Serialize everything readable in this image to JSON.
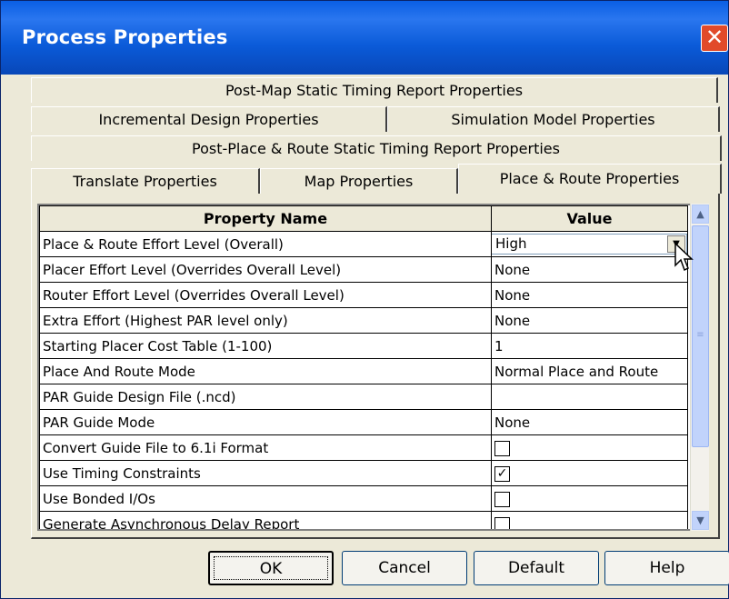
{
  "window": {
    "title": "Process Properties",
    "close_label": "✕"
  },
  "tabs": {
    "row1": [
      "Post-Map Static Timing Report Properties"
    ],
    "row2": [
      "Incremental Design Properties",
      "Simulation Model Properties"
    ],
    "row3": [
      "Post-Place & Route Static Timing Report Properties"
    ],
    "row4": [
      "Translate Properties",
      "Map Properties",
      "Place & Route Properties"
    ],
    "active": "Place & Route Properties"
  },
  "grid": {
    "headers": {
      "name": "Property Name",
      "value": "Value"
    },
    "rows": [
      {
        "name": "Place & Route Effort Level (Overall)",
        "value": "High",
        "kind": "combo"
      },
      {
        "name": "Placer Effort Level (Overrides Overall Level)",
        "value": "None",
        "kind": "text"
      },
      {
        "name": "Router Effort Level (Overrides Overall Level)",
        "value": "None",
        "kind": "text"
      },
      {
        "name": "Extra Effort (Highest PAR level only)",
        "value": "None",
        "kind": "text"
      },
      {
        "name": "Starting Placer Cost Table (1-100)",
        "value": "1",
        "kind": "text"
      },
      {
        "name": "Place And Route Mode",
        "value": "Normal Place and Route",
        "kind": "text"
      },
      {
        "name": "PAR Guide Design File (.ncd)",
        "value": "",
        "kind": "text"
      },
      {
        "name": "PAR Guide Mode",
        "value": "None",
        "kind": "text"
      },
      {
        "name": "Convert Guide File to 6.1i Format",
        "value": "",
        "kind": "checkbox",
        "checked": false
      },
      {
        "name": "Use Timing Constraints",
        "value": "",
        "kind": "checkbox",
        "checked": true
      },
      {
        "name": "Use Bonded I/Os",
        "value": "",
        "kind": "checkbox",
        "checked": false
      },
      {
        "name": "Generate Asynchronous Delay Report",
        "value": "",
        "kind": "checkbox",
        "checked": false
      }
    ]
  },
  "buttons": {
    "ok": "OK",
    "cancel": "Cancel",
    "default": "Default",
    "help": "Help"
  },
  "colors": {
    "titlebar": "#0a5fe4",
    "dialog": "#ece9d8",
    "close": "#e14a2a"
  }
}
